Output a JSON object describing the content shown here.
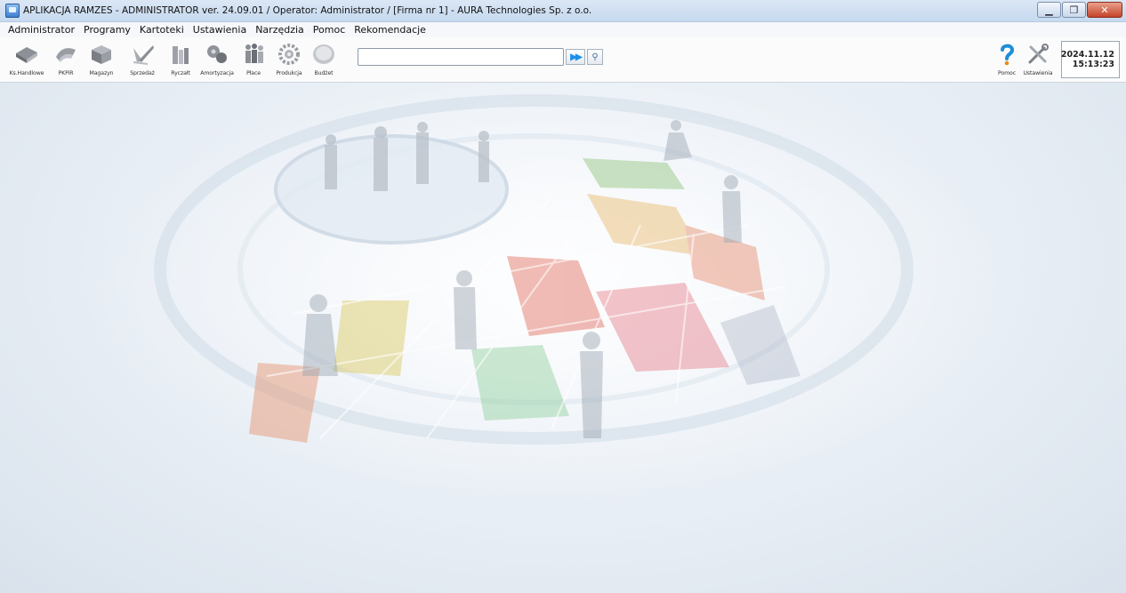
{
  "window": {
    "title": "APLIKACJA RAMZES - ADMINISTRATOR ver. 24.09.01 /  Operator: Administrator /  [Firma nr 1] - AURA Technologies Sp. z o.o.",
    "icon": "app-icon"
  },
  "menu": {
    "items": [
      {
        "label": "Administrator"
      },
      {
        "label": "Programy"
      },
      {
        "label": "Kartoteki"
      },
      {
        "label": "Ustawienia"
      },
      {
        "label": "Narzędzia"
      },
      {
        "label": "Pomoc"
      },
      {
        "label": "Rekomendacje"
      }
    ]
  },
  "toolbar": {
    "modules": [
      {
        "label": "Ks.Handlowe",
        "icon": "book-icon"
      },
      {
        "label": "PKPiR",
        "icon": "ledger-icon"
      },
      {
        "label": "Magazyn",
        "icon": "box-icon"
      },
      {
        "label": "Sprzedaż",
        "icon": "pen-icon"
      },
      {
        "label": "Ryczałt",
        "icon": "columns-icon"
      },
      {
        "label": "Amortyzacja",
        "icon": "gears-icon"
      },
      {
        "label": "Płace",
        "icon": "people-icon"
      },
      {
        "label": "Produkcja",
        "icon": "cog-icon"
      },
      {
        "label": "Budżet",
        "icon": "coin-icon"
      }
    ],
    "search": {
      "value": "",
      "placeholder": ""
    },
    "help_label": "Pomoc",
    "settings_label": "Ustawienia",
    "clock": {
      "date": "2024.11.12",
      "time": "15:13:23"
    }
  }
}
